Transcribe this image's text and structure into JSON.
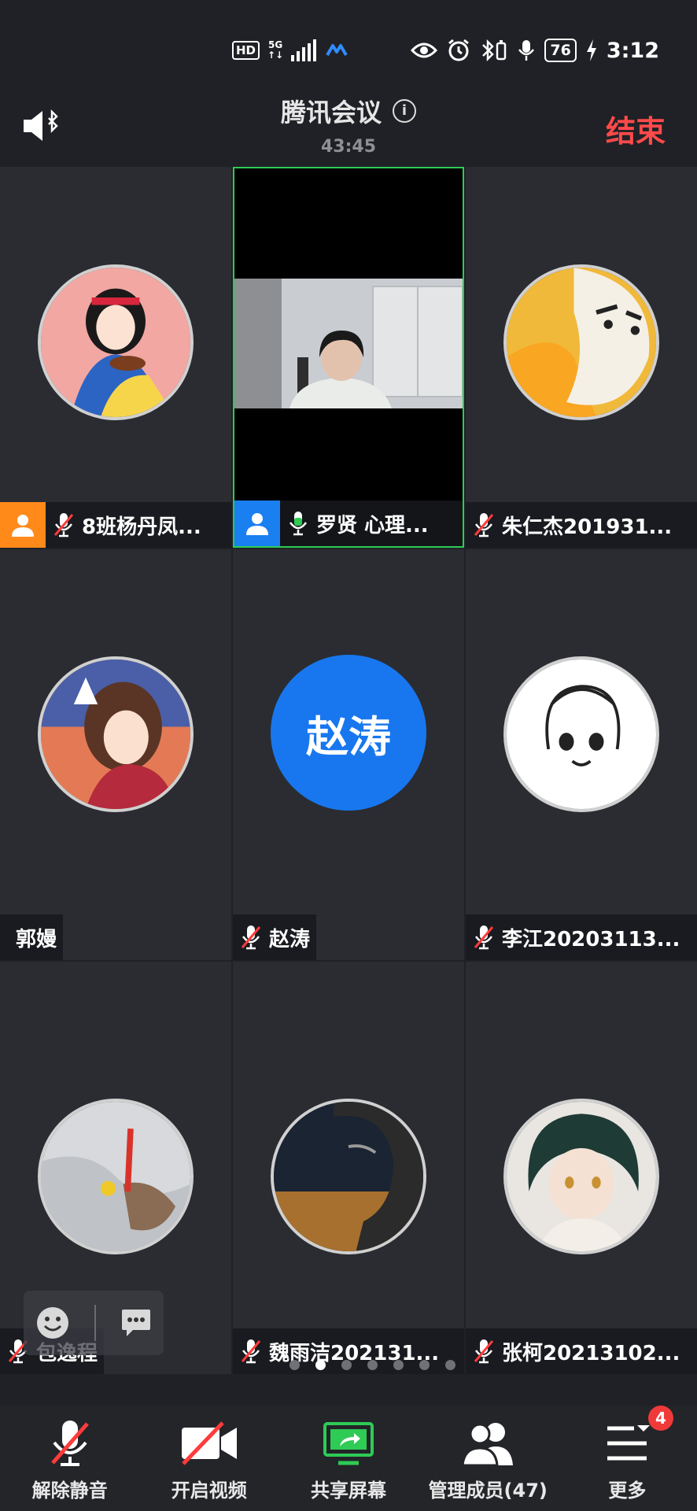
{
  "status_bar": {
    "hd": "HD",
    "network": "5G",
    "battery": "76",
    "time": "3:12"
  },
  "header": {
    "title": "腾讯会议",
    "timer": "43:45",
    "end_label": "结束"
  },
  "tiles": [
    {
      "name": "8班杨丹凤...",
      "muted": true,
      "tag": "orange",
      "avatar": "snow-white"
    },
    {
      "name": "罗贤  心理...",
      "muted": false,
      "tag": "blue",
      "video": true,
      "active": true
    },
    {
      "name": "朱仁杰201931...",
      "muted": true,
      "avatar": "duck"
    },
    {
      "name": "郭嫚",
      "muted": null,
      "avatar": "fox-mask-girl"
    },
    {
      "name": "赵涛",
      "muted": true,
      "initials": "赵涛"
    },
    {
      "name": "李江20203113...",
      "muted": true,
      "avatar": "line-drawing"
    },
    {
      "name": "包逸程",
      "muted": true,
      "avatar": "hand-blanket"
    },
    {
      "name": "魏雨洁202131...",
      "muted": true,
      "avatar": "dark-photo"
    },
    {
      "name": "张柯20213102...",
      "muted": true,
      "avatar": "anime-boy"
    }
  ],
  "pager": {
    "count": 7,
    "current": 1
  },
  "toolbar": {
    "unmute": "解除静音",
    "video": "开启视频",
    "share": "共享屏幕",
    "members": "管理成员(47)",
    "more": "更多",
    "more_badge": "4"
  },
  "colors": {
    "end": "#ff4a4a",
    "accent_blue": "#1a7ff0",
    "active_green": "#2ecb55",
    "tag_orange": "#ff8a1a"
  }
}
